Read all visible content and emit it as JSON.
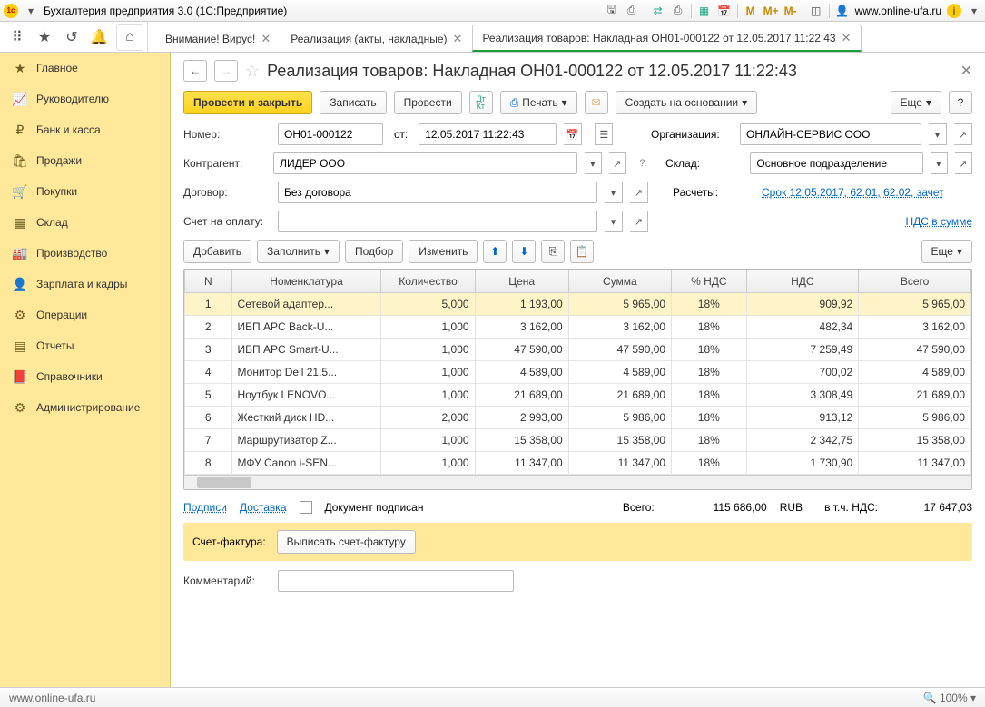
{
  "titlebar": {
    "app_title": "Бухгалтерия предприятия 3.0   (1С:Предприятие)",
    "right_labels": {
      "m": "M",
      "mplus": "M+",
      "mminus": "M-",
      "user": "www.online-ufa.ru"
    }
  },
  "tabs": [
    {
      "label": "Внимание! Вирус!",
      "active": false
    },
    {
      "label": "Реализация (акты, накладные)",
      "active": false
    },
    {
      "label": "Реализация товаров: Накладная ОН01-000122 от 12.05.2017 11:22:43",
      "active": true
    }
  ],
  "sidebar": [
    {
      "label": "Главное",
      "icon": "star"
    },
    {
      "label": "Руководителю",
      "icon": "chart"
    },
    {
      "label": "Банк и касса",
      "icon": "coin"
    },
    {
      "label": "Продажи",
      "icon": "bag"
    },
    {
      "label": "Покупки",
      "icon": "cart"
    },
    {
      "label": "Склад",
      "icon": "boxes"
    },
    {
      "label": "Производство",
      "icon": "factory"
    },
    {
      "label": "Зарплата и кадры",
      "icon": "person"
    },
    {
      "label": "Операции",
      "icon": "ops"
    },
    {
      "label": "Отчеты",
      "icon": "report"
    },
    {
      "label": "Справочники",
      "icon": "book"
    },
    {
      "label": "Администрирование",
      "icon": "gear"
    }
  ],
  "doc": {
    "title": "Реализация товаров: Накладная ОН01-000122 от 12.05.2017 11:22:43",
    "toolbar": {
      "post_close": "Провести и закрыть",
      "save": "Записать",
      "post": "Провести",
      "print": "Печать",
      "create_based": "Создать на основании",
      "more": "Еще"
    },
    "labels": {
      "number": "Номер:",
      "from": "от:",
      "org": "Организация:",
      "counterparty": "Контрагент:",
      "warehouse": "Склад:",
      "contract": "Договор:",
      "calculations": "Расчеты:",
      "invoice_order": "Счет на оплату:",
      "vat_in_sum": "НДС в сумме",
      "signatures": "Подписи",
      "delivery": "Доставка",
      "doc_signed": "Документ подписан",
      "total": "Всего:",
      "currency": "RUB",
      "incl_vat": "в т.ч. НДС:",
      "invoice": "Счет-фактура:",
      "issue_invoice": "Выписать счет-фактуру",
      "comment": "Комментарий:"
    },
    "values": {
      "number": "ОН01-000122",
      "date": "12.05.2017 11:22:43",
      "org": "ОНЛАЙН-СЕРВИС ООО",
      "counterparty": "ЛИДЕР ООО",
      "warehouse": "Основное подразделение",
      "contract": "Без договора",
      "calculations": "Срок 12.05.2017, 62.01, 62.02, зачет ",
      "total": "115 686,00",
      "vat_total": "17 647,03"
    },
    "table_toolbar": {
      "add": "Добавить",
      "fill": "Заполнить",
      "pick": "Подбор",
      "change": "Изменить",
      "more": "Еще"
    },
    "columns": [
      "N",
      "Номенклатура",
      "Количество",
      "Цена",
      "Сумма",
      "% НДС",
      "НДС",
      "Всего"
    ],
    "rows": [
      {
        "n": "1",
        "name": "Сетевой адаптер...",
        "qty": "5,000",
        "price": "1 193,00",
        "sum": "5 965,00",
        "vatp": "18%",
        "vat": "909,92",
        "total": "5 965,00"
      },
      {
        "n": "2",
        "name": "ИБП APC Back-U...",
        "qty": "1,000",
        "price": "3 162,00",
        "sum": "3 162,00",
        "vatp": "18%",
        "vat": "482,34",
        "total": "3 162,00"
      },
      {
        "n": "3",
        "name": "ИБП APC Smart-U...",
        "qty": "1,000",
        "price": "47 590,00",
        "sum": "47 590,00",
        "vatp": "18%",
        "vat": "7 259,49",
        "total": "47 590,00"
      },
      {
        "n": "4",
        "name": "Монитор Dell 21.5...",
        "qty": "1,000",
        "price": "4 589,00",
        "sum": "4 589,00",
        "vatp": "18%",
        "vat": "700,02",
        "total": "4 589,00"
      },
      {
        "n": "5",
        "name": "Ноутбук LENOVO...",
        "qty": "1,000",
        "price": "21 689,00",
        "sum": "21 689,00",
        "vatp": "18%",
        "vat": "3 308,49",
        "total": "21 689,00"
      },
      {
        "n": "6",
        "name": "Жесткий диск HD...",
        "qty": "2,000",
        "price": "2 993,00",
        "sum": "5 986,00",
        "vatp": "18%",
        "vat": "913,12",
        "total": "5 986,00"
      },
      {
        "n": "7",
        "name": "Маршрутизатор Z...",
        "qty": "1,000",
        "price": "15 358,00",
        "sum": "15 358,00",
        "vatp": "18%",
        "vat": "2 342,75",
        "total": "15 358,00"
      },
      {
        "n": "8",
        "name": "МФУ Canon i-SEN...",
        "qty": "1,000",
        "price": "11 347,00",
        "sum": "11 347,00",
        "vatp": "18%",
        "vat": "1 730,90",
        "total": "11 347,00"
      }
    ]
  },
  "statusbar": {
    "left": "www.online-ufa.ru",
    "zoom": "100%"
  }
}
